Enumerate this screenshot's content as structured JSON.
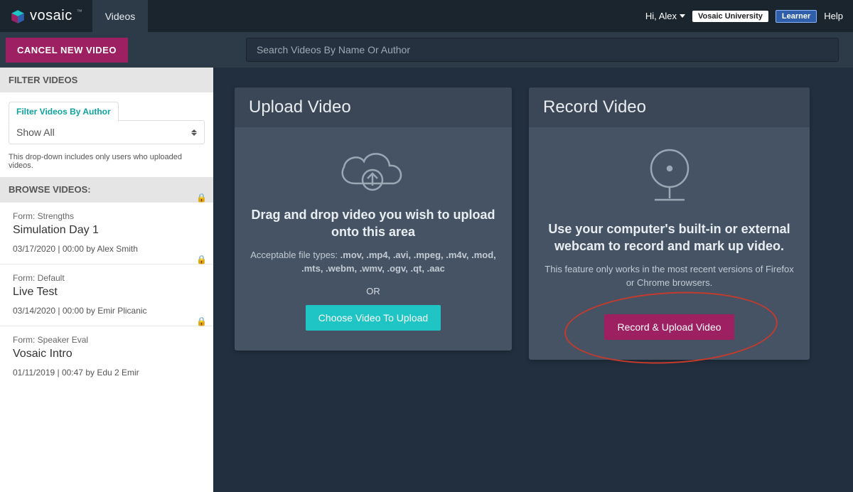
{
  "header": {
    "brand": "vosaic",
    "tab": "Videos",
    "greeting": "Hi, Alex",
    "university_badge": "Vosaic University",
    "role_badge": "Learner",
    "help": "Help"
  },
  "actions": {
    "cancel_label": "CANCEL NEW VIDEO",
    "search_placeholder": "Search Videos By Name Or Author"
  },
  "sidebar": {
    "filter_heading": "FILTER VIDEOS",
    "filter_tab": "Filter Videos By Author",
    "filter_selected": "Show All",
    "filter_hint": "This drop-down includes only users who uploaded videos.",
    "browse_heading": "BROWSE VIDEOS:",
    "videos": [
      {
        "form": "Form: Strengths",
        "title": "Simulation Day 1",
        "meta": "03/17/2020 | 00:00 by Alex Smith"
      },
      {
        "form": "Form: Default",
        "title": "Live Test",
        "meta": "03/14/2020 | 00:00 by Emir Plicanic"
      },
      {
        "form": "Form: Speaker Eval",
        "title": "Vosaic Intro",
        "meta": "01/11/2019 | 00:47 by Edu 2 Emir"
      }
    ]
  },
  "upload": {
    "title": "Upload Video",
    "headline": "Drag and drop video you wish to upload onto this area",
    "types_label": "Acceptable file types: ",
    "types": ".mov, .mp4, .avi, .mpeg, .m4v, .mod, .mts, .webm, .wmv, .ogv, .qt, .aac",
    "or": "OR",
    "choose_label": "Choose Video To Upload"
  },
  "record": {
    "title": "Record Video",
    "headline": "Use your computer's built-in or external webcam to record and mark up video.",
    "sub": "This feature only works in the most recent versions of Firefox or Chrome browsers.",
    "button_label": "Record & Upload Video"
  }
}
